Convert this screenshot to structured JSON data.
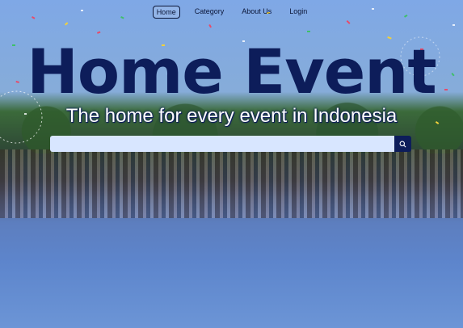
{
  "nav": {
    "items": [
      {
        "label": "Home",
        "active": true
      },
      {
        "label": "Category",
        "active": false
      },
      {
        "label": "About Us",
        "active": false
      },
      {
        "label": "Login",
        "active": false
      }
    ]
  },
  "hero": {
    "title": "Home Event",
    "subtitle": "The home for every event in Indonesia"
  },
  "search": {
    "value": "",
    "placeholder": "",
    "icon": "search-icon"
  },
  "colors": {
    "title": "#0d1d5a",
    "accent": "#0d1d5a",
    "search_bg": "#d8e6ff",
    "background": "#6a8fd0"
  }
}
